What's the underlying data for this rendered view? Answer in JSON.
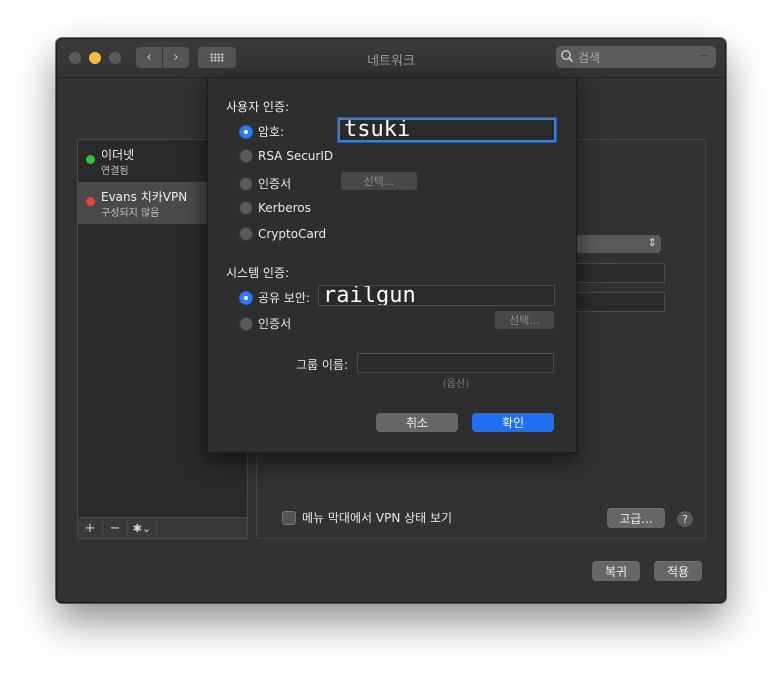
{
  "window": {
    "title": "네트워크"
  },
  "search": {
    "placeholder": "검색",
    "icon": "search-icon"
  },
  "services": [
    {
      "name": "이더넷",
      "status": "연결됨",
      "color": "#36c23a"
    },
    {
      "name": "Evans 치카VPN",
      "status": "구성되지 않음",
      "color": "#e8403b"
    }
  ],
  "sidebar_toolbar": {
    "add": "+",
    "remove": "−",
    "gear": "✱⌄"
  },
  "main": {
    "show_vpn_status": "메뉴 막대에서 VPN 상태 보기",
    "advanced_button": "고급...",
    "help": "?",
    "revert_button": "복귀",
    "apply_button": "적용"
  },
  "sheet": {
    "user_auth_title": "사용자 인증:",
    "user_auth_options": [
      "암호:",
      "RSA SecurID",
      "인증서",
      "Kerberos",
      "CryptoCard"
    ],
    "user_selected": 0,
    "password_value": "tsuki",
    "cert_select_button": "선택...",
    "system_auth_title": "시스템 인증:",
    "system_auth_options": [
      "공유 보안:",
      "인증서"
    ],
    "system_selected": 0,
    "shared_secret_value": "railgun",
    "system_cert_select_button": "선택...",
    "group_name_label": "그룹 이름:",
    "group_name_value": "",
    "optional_label": "(옵션)",
    "cancel_button": "취소",
    "ok_button": "확인"
  },
  "colors": {
    "accent": "#1e6ff2",
    "window_bg": "#323232",
    "sheet_bg": "#2e2e2e"
  }
}
